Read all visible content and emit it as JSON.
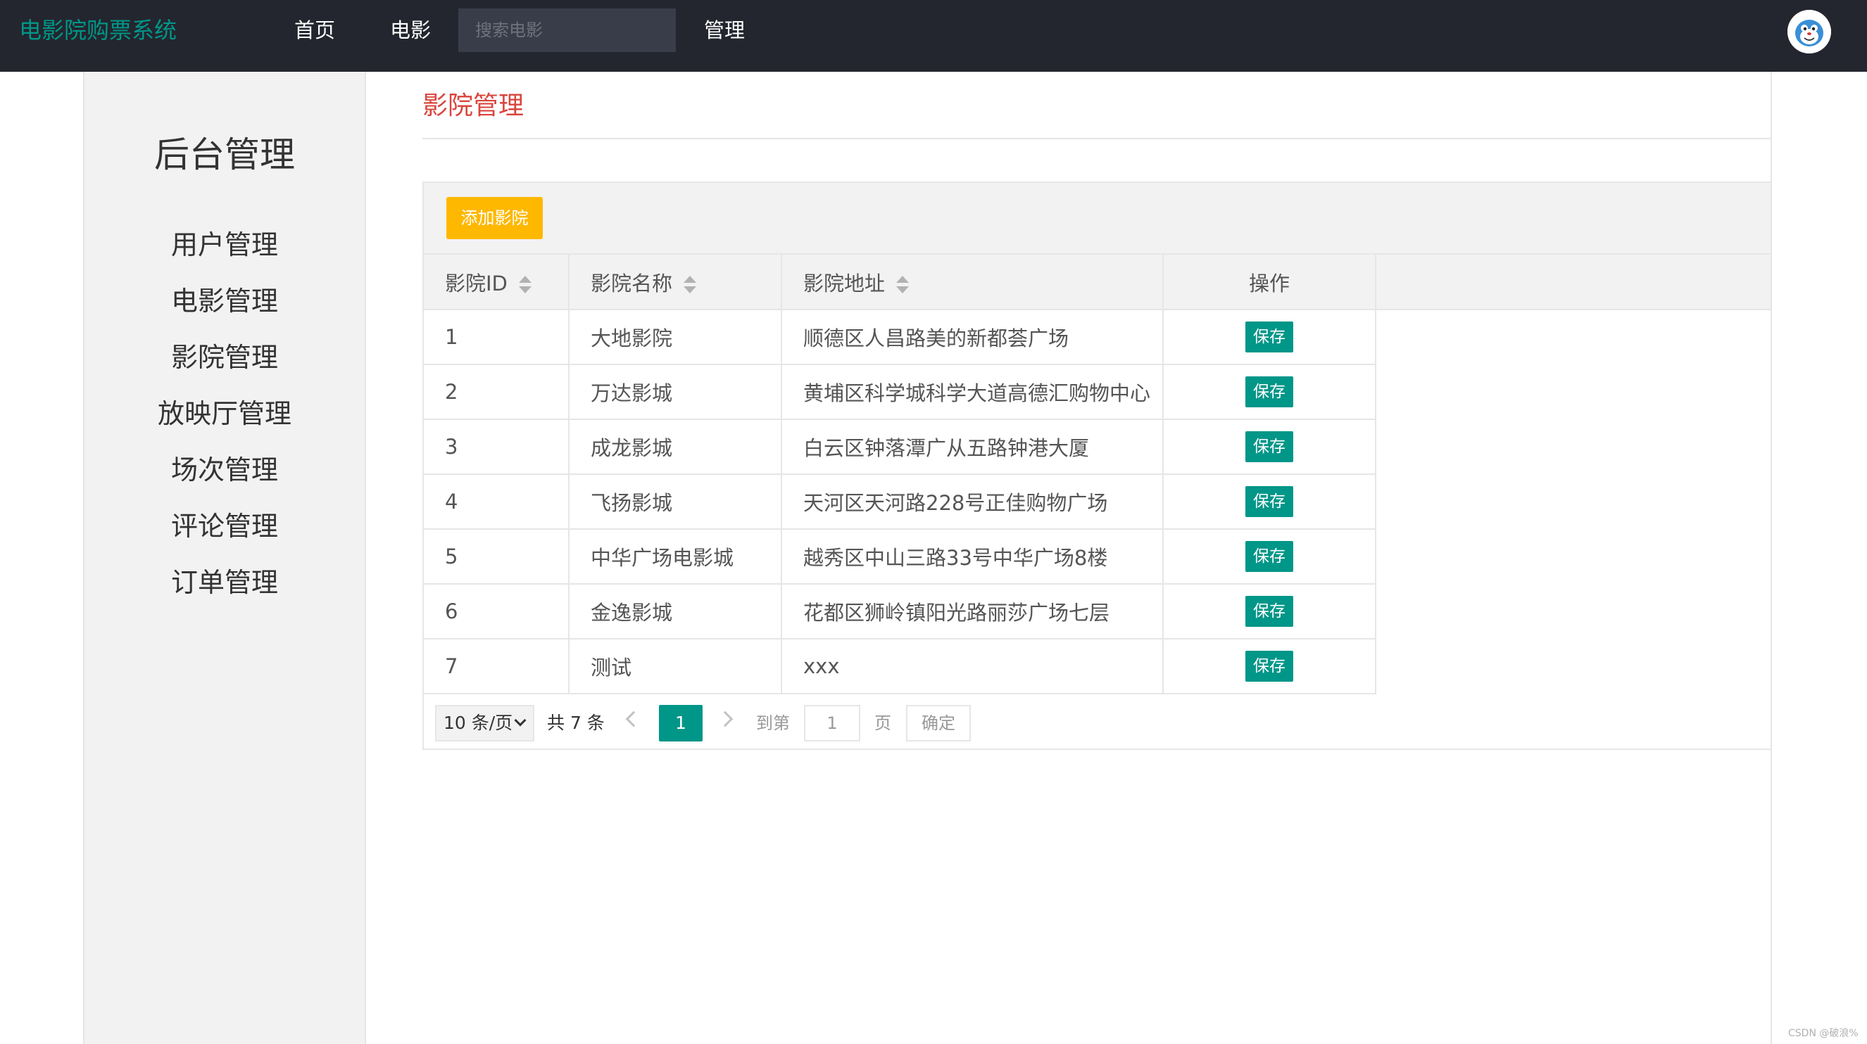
{
  "nav": {
    "brand": "电影院购票系统",
    "home": "首页",
    "movie": "电影",
    "search_placeholder": "搜索电影",
    "admin": "管理"
  },
  "sidebar": {
    "title": "后台管理",
    "items": [
      "用户管理",
      "电影管理",
      "影院管理",
      "放映厅管理",
      "场次管理",
      "评论管理",
      "订单管理"
    ]
  },
  "main": {
    "title": "影院管理",
    "add_button": "添加影院"
  },
  "table": {
    "headers": {
      "id": "影院ID",
      "name": "影院名称",
      "address": "影院地址",
      "action": "操作"
    },
    "action_label": "保存",
    "rows": [
      {
        "id": "1",
        "name": "大地影院",
        "address": "顺德区人昌路美的新都荟广场"
      },
      {
        "id": "2",
        "name": "万达影城",
        "address": "黄埔区科学城科学大道高德汇购物中心"
      },
      {
        "id": "3",
        "name": "成龙影城",
        "address": "白云区钟落潭广从五路钟港大厦"
      },
      {
        "id": "4",
        "name": "飞扬影城",
        "address": "天河区天河路228号正佳购物广场"
      },
      {
        "id": "5",
        "name": "中华广场电影城",
        "address": "越秀区中山三路33号中华广场8楼"
      },
      {
        "id": "6",
        "name": "金逸影城",
        "address": "花都区狮岭镇阳光路丽莎广场七层"
      },
      {
        "id": "7",
        "name": "测试",
        "address": "xxx"
      }
    ]
  },
  "pager": {
    "limit": "10 条/页",
    "count": "共 7 条",
    "current": "1",
    "goto_label": "到第",
    "goto_value": "1",
    "page_label": "页",
    "confirm": "确定"
  },
  "watermark": "CSDN @破浪%",
  "colors": {
    "topbar": "#23262e",
    "brand": "#009688",
    "accent": "#009688",
    "add_button": "#ffb800",
    "page_title": "#d9453d"
  }
}
